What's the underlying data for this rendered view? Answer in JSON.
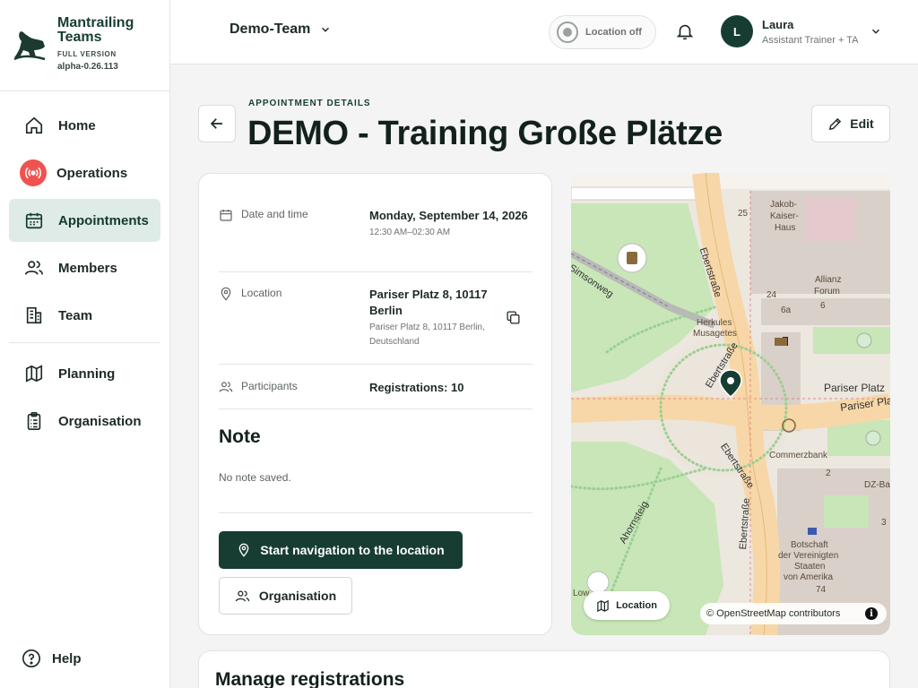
{
  "brand": {
    "name": "Mantrailing Teams",
    "edition": "FULL VERSION",
    "build": "alpha-0.26.113"
  },
  "sidebar": {
    "items": [
      {
        "label": "Home",
        "icon": "home-icon"
      },
      {
        "label": "Operations",
        "icon": "broadcast-icon"
      },
      {
        "label": "Appointments",
        "icon": "calendar-icon",
        "active": true
      },
      {
        "label": "Members",
        "icon": "users-icon"
      },
      {
        "label": "Team",
        "icon": "building-icon"
      },
      {
        "label": "Planning",
        "icon": "map-icon"
      },
      {
        "label": "Organisation",
        "icon": "clipboard-icon"
      }
    ],
    "help_label": "Help"
  },
  "topbar": {
    "team": "Demo-Team",
    "location_status": "Location off",
    "user": {
      "initial": "L",
      "name": "Laura",
      "role": "Assistant Trainer + TA"
    }
  },
  "header": {
    "eyebrow": "APPOINTMENT DETAILS",
    "title": "DEMO - Training Große Plätze",
    "edit_label": "Edit"
  },
  "details": {
    "datetime": {
      "label": "Date and time",
      "date": "Monday, September 14, 2026",
      "time": "12:30 AM–02:30 AM"
    },
    "location": {
      "label": "Location",
      "name": "Pariser Platz 8, 10117 Berlin",
      "address": "Pariser Platz 8, 10117 Berlin, Deutschland"
    },
    "participants": {
      "label": "Participants",
      "value": "Registrations: 10"
    },
    "note": {
      "heading": "Note",
      "text": "No note saved."
    },
    "navigate_label": "Start navigation to the location",
    "organisation_label": "Organisation"
  },
  "map": {
    "button_label": "Location",
    "attribution": "© OpenStreetMap contributors",
    "labels": {
      "jakob": "Jakob-",
      "kaiser": "Kaiser-",
      "haus": "Haus",
      "allianz": "Allianz",
      "forum": "Forum",
      "herkules": "Herkules",
      "musagetes": "Musagetes",
      "pariser1": "Pariser Platz",
      "pariser2": "Pariser Pla",
      "commerzbank": "Commerzbank",
      "dzbank": "DZ-Ba",
      "botschaft1": "Botschaft",
      "botschaft2": "der Vereinigten",
      "botschaft3": "Staaten",
      "botschaft4": "von Amerika",
      "simsonweg": "Simsonweg",
      "ebert1": "Ebertstraße",
      "ebert2": "Ebertstraße",
      "ebert3": "Ebertstraße",
      "ebert4": "Ebertstraße",
      "ahornsteig": "Ahornsteig",
      "num25": "25",
      "num24": "24",
      "num6a": "6a",
      "num6": "6",
      "num74": "74",
      "num2": "2",
      "num3": "3",
      "low": "Low"
    }
  },
  "manage": {
    "heading": "Manage registrations"
  }
}
